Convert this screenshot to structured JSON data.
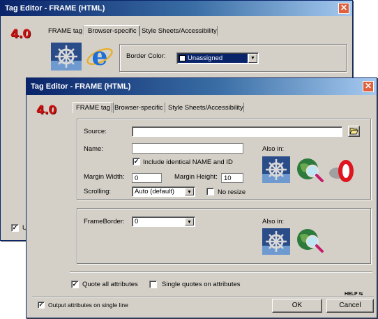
{
  "back_window": {
    "title": "Tag Editor - FRAME  (HTML)",
    "version": "4.0",
    "tabs": [
      "FRAME tag",
      "Browser-specific",
      "Style Sheets/Accessibility"
    ],
    "border_color_label": "Border Color:",
    "border_color_value": "Unassigned",
    "partial_checkbox_label": "U"
  },
  "front_window": {
    "title": "Tag Editor - FRAME  (HTML)",
    "version": "4.0",
    "tabs": [
      "FRAME tag",
      "Browser-specific",
      "Style Sheets/Accessibility"
    ],
    "source_label": "Source:",
    "source_value": "",
    "name_label": "Name:",
    "name_value": "",
    "include_identical_label": "Include identical NAME and ID",
    "margin_width_label": "Margin Width:",
    "margin_width_value": "0",
    "margin_height_label": "Margin Height:",
    "margin_height_value": "10",
    "scrolling_label": "Scrolling:",
    "scrolling_value": "Auto (default)",
    "noresize_label": "No resize",
    "also_in_label": "Also in:",
    "frameborder_label": "FrameBorder:",
    "frameborder_value": "0",
    "also_in_label_2": "Also in:",
    "quote_all_label": "Quote all attributes",
    "single_quotes_label": "Single quotes on attributes",
    "help_label": "HELP",
    "output_single_line_label": "Output attributes on single line",
    "ok_label": "OK",
    "cancel_label": "Cancel"
  },
  "checkboxes": {
    "include_identical": true,
    "noresize": false,
    "quote_all": true,
    "single_quotes": false,
    "output_single_line": true,
    "back_partial": true
  },
  "colors": {
    "title_bar": "#0a246a",
    "version_red": "#cc1010",
    "dialog_face": "#d4d0c8",
    "selection": "#0a246a"
  },
  "icons": {
    "back": [
      "ship-wheel-icon",
      "internet-explorer-icon"
    ],
    "also_in_1": [
      "ship-wheel-icon",
      "globe-magnifier-icon",
      "opera-icon"
    ],
    "also_in_2": [
      "ship-wheel-icon",
      "globe-magnifier-icon"
    ],
    "source_browse": "folder-open-icon"
  }
}
